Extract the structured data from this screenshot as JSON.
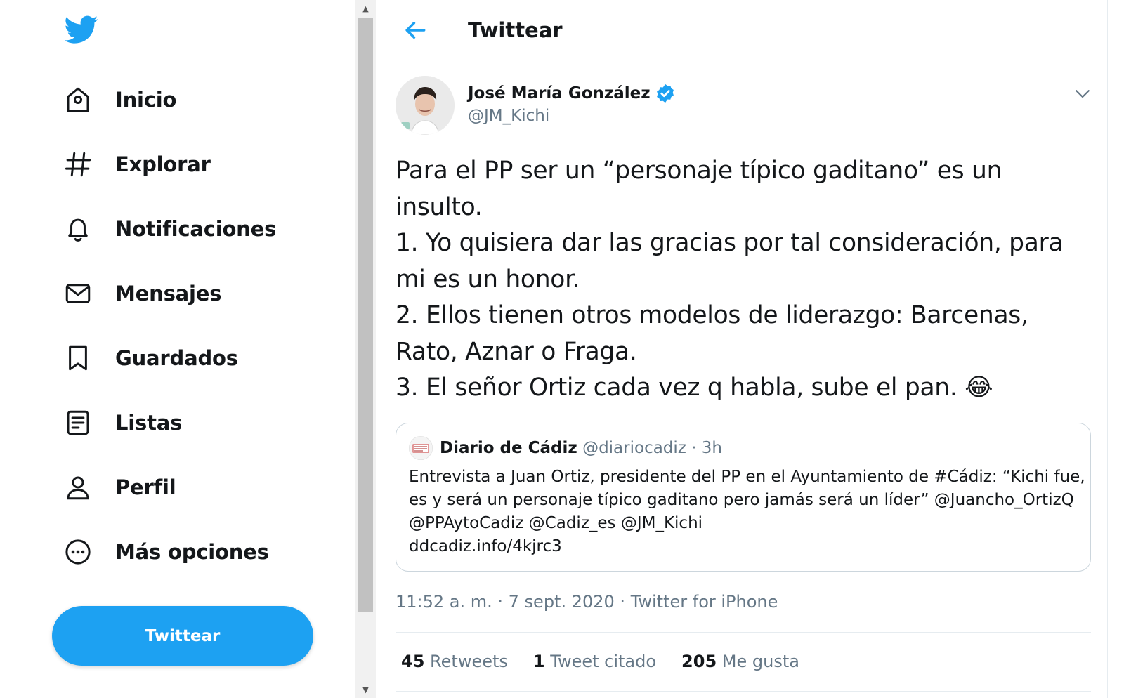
{
  "colors": {
    "accent": "#1da1f2",
    "text": "#14171a",
    "muted": "#657786",
    "border": "#e6ecf0"
  },
  "sidebar": {
    "logo_icon": "twitter-bird-icon",
    "items": [
      {
        "label": "Inicio",
        "icon": "home-icon"
      },
      {
        "label": "Explorar",
        "icon": "hashtag-icon"
      },
      {
        "label": "Notificaciones",
        "icon": "bell-icon"
      },
      {
        "label": "Mensajes",
        "icon": "envelope-icon"
      },
      {
        "label": "Guardados",
        "icon": "bookmark-icon"
      },
      {
        "label": "Listas",
        "icon": "list-icon"
      },
      {
        "label": "Perfil",
        "icon": "person-icon"
      },
      {
        "label": "Más opciones",
        "icon": "more-options-icon"
      }
    ],
    "tweet_button": "Twittear"
  },
  "header": {
    "title": "Twittear",
    "back_icon": "back-arrow-icon"
  },
  "tweet": {
    "author_name": "José María González",
    "handle": "@JM_Kichi",
    "verified": true,
    "lines": [
      "Para el PP ser un “personaje típico gaditano” es un",
      "insulto.",
      "1. Yo quisiera dar las gracias por tal consideración, para",
      "mi es un honor.",
      "2. Ellos tienen otros modelos de liderazgo: Barcenas,",
      "Rato, Aznar o Fraga.",
      "3. El señor Ortiz cada vez q habla, sube el pan. 😂"
    ],
    "quote": {
      "name": "Diario de Cádiz",
      "meta": "@diariocadiz · 3h",
      "lines": [
        "Entrevista a Juan Ortiz, presidente del PP en el Ayuntamiento de #Cádiz: “Kichi fue,",
        "es y será un personaje típico gaditano pero jamás será un líder” @Juancho_OrtizQ",
        "@PPAytoCadiz @Cadiz_es @JM_Kichi",
        " ddcadiz.info/4kjrc3"
      ]
    },
    "timestamp": "11:52 a. m. · 7 sept. 2020 · Twitter for iPhone",
    "stats": [
      {
        "count": "45",
        "label": "Retweets"
      },
      {
        "count": "1",
        "label": "Tweet citado"
      },
      {
        "count": "205",
        "label": "Me gusta"
      }
    ]
  }
}
